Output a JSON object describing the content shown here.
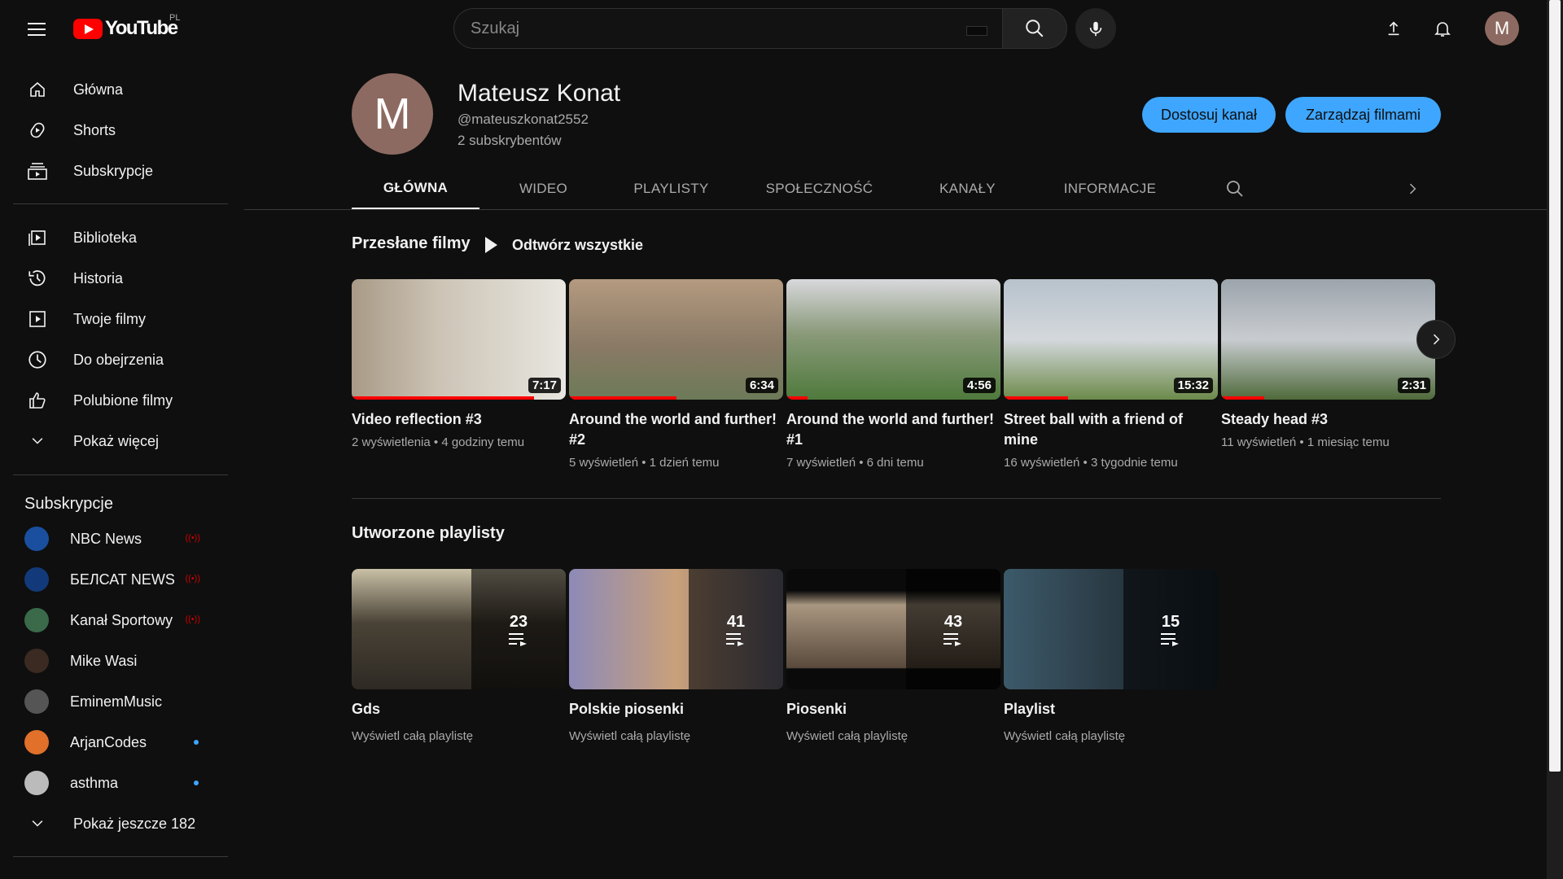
{
  "topbar": {
    "logo_text": "YouTube",
    "country_code": "PL",
    "search_placeholder": "Szukaj"
  },
  "sidebar": {
    "main": [
      {
        "label": "Główna",
        "icon": "home-icon"
      },
      {
        "label": "Shorts",
        "icon": "shorts-icon"
      },
      {
        "label": "Subskrypcje",
        "icon": "subscriptions-icon"
      }
    ],
    "library": [
      {
        "label": "Biblioteka",
        "icon": "library-icon"
      },
      {
        "label": "Historia",
        "icon": "history-icon"
      },
      {
        "label": "Twoje filmy",
        "icon": "your-videos-icon"
      },
      {
        "label": "Do obejrzenia",
        "icon": "watch-later-icon"
      },
      {
        "label": "Polubione filmy",
        "icon": "liked-icon"
      },
      {
        "label": "Pokaż więcej",
        "icon": "chevron-down-icon"
      }
    ],
    "subscriptions_heading": "Subskrypcje",
    "subscriptions": [
      {
        "label": "NBC News",
        "status": "live",
        "color": "#1a4fa0"
      },
      {
        "label": "БЕЛСАТ NEWS",
        "status": "live",
        "color": "#123a7a"
      },
      {
        "label": "Kanał Sportowy",
        "status": "live",
        "color": "#3a6a4a"
      },
      {
        "label": "Mike Wasi",
        "status": "",
        "color": "#3b2a22"
      },
      {
        "label": "EminemMusic",
        "status": "",
        "color": "#555555"
      },
      {
        "label": "ArjanCodes",
        "status": "new",
        "color": "#e0702a"
      },
      {
        "label": "asthma",
        "status": "new",
        "color": "#bbbbbb"
      }
    ],
    "show_more_subs": "Pokaż jeszcze 182"
  },
  "channel": {
    "avatar_letter": "M",
    "name": "Mateusz Konat",
    "handle": "@mateuszkonat2552",
    "subscribers": "2 subskrybentów",
    "customize_label": "Dostosuj kanał",
    "manage_label": "Zarządzaj filmami",
    "tabs": [
      "GŁÓWNA",
      "WIDEO",
      "PLAYLISTY",
      "SPOŁECZNOŚĆ",
      "KANAŁY",
      "INFORMACJE"
    ],
    "active_tab": "GŁÓWNA"
  },
  "uploads": {
    "title": "Przesłane filmy",
    "play_all": "Odtwórz wszystkie",
    "videos": [
      {
        "title": "Video reflection #3",
        "views": "2 wyświetlenia",
        "age": "4 godziny temu",
        "duration": "7:17",
        "watched": 0.85,
        "colors": [
          "#a89a86",
          "#e8e6e0"
        ]
      },
      {
        "title": "Around the world and further! #2",
        "views": "5 wyświetleń",
        "age": "1 dzień temu",
        "duration": "6:34",
        "watched": 0.5,
        "colors": [
          "#b49a80",
          "#6c7a58"
        ]
      },
      {
        "title": "Around the world and further! #1",
        "views": "7 wyświetleń",
        "age": "6 dni temu",
        "duration": "4:56",
        "watched": 0.1,
        "colors": [
          "#d8d8dc",
          "#4f7a3c"
        ]
      },
      {
        "title": "Street ball with a friend of mine",
        "views": "16 wyświetleń",
        "age": "3 tygodnie temu",
        "duration": "15:32",
        "watched": 0.3,
        "colors": [
          "#b7c2cc",
          "#6c8a4a"
        ]
      },
      {
        "title": "Steady head #3",
        "views": "11 wyświetleń",
        "age": "1 miesiąc temu",
        "duration": "2:31",
        "watched": 0.2,
        "colors": [
          "#9ca4ac",
          "#4f6a3a"
        ]
      }
    ]
  },
  "playlists": {
    "title": "Utworzone playlisty",
    "items": [
      {
        "title": "Gds",
        "count": "23",
        "link": "Wyświetl całą playlistę",
        "colors": [
          "#c9c0a6",
          "#2e2a24"
        ]
      },
      {
        "title": "Polskie piosenki",
        "count": "41",
        "link": "Wyświetl całą playlistę",
        "colors": [
          "#8d8ab8",
          "#c9a07a"
        ]
      },
      {
        "title": "Piosenki",
        "count": "43",
        "link": "Wyświetl całą playlistę",
        "colors": [
          "#a89680",
          "#5a4a3c"
        ]
      },
      {
        "title": "Playlist",
        "count": "15",
        "link": "Wyświetl całą playlistę",
        "colors": [
          "#3c5a6a",
          "#1a2630"
        ]
      }
    ]
  }
}
